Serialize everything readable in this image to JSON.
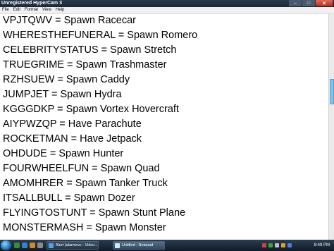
{
  "window": {
    "title": "Unregistered HyperCam 3"
  },
  "menu": [
    "File",
    "Edit",
    "Format",
    "View",
    "Help"
  ],
  "lines": [
    "VPJTQWV = Spawn Racecar",
    "WHERESTHEFUNERAL = Spawn Romero",
    "CELEBRITYSTATUS = Spawn Stretch",
    "TRUEGRIME = Spawn Trashmaster",
    "RZHSUEW = Spawn Caddy",
    "JUMPJET = Spawn Hydra",
    "KGGGDKP = Spawn Vortex Hovercraft",
    "AIYPWZQP = Have Parachute",
    "ROCKETMAN = Have Jetpack",
    "OHDUDE = Spawn Hunter",
    "FOURWHEELFUN = Spawn Quad",
    "AMOMHRER = Spawn Tanker Truck",
    "ITSALLBULL = Spawn Dozer",
    "FLYINGTOSTUNT = Spawn Stunt Plane",
    "MONSTERMASH = Spawn Monster"
  ],
  "taskbar": {
    "buttons": [
      "Alert (alarmcvc - Vidco...",
      "Untitled - Notepad"
    ],
    "clock": "8:49 PM"
  },
  "colors": {
    "titlebar": "#1a2634",
    "taskbar": "#0f1a26",
    "scroll_thumb": "#7fc4e8"
  }
}
